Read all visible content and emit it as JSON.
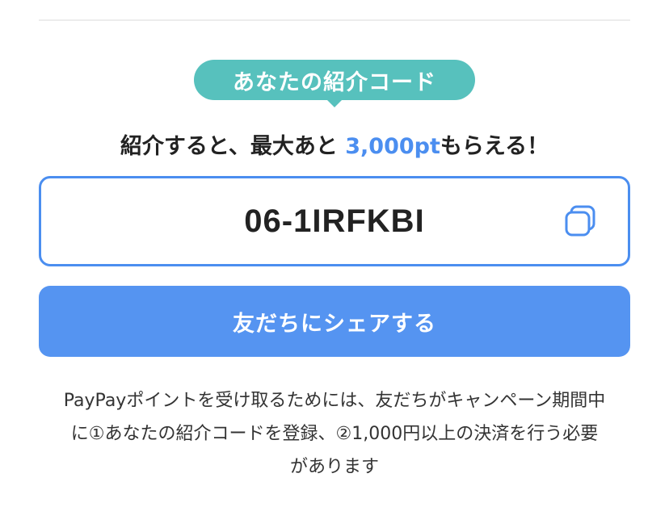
{
  "badge": {
    "label": "あなたの紹介コード"
  },
  "headline": {
    "prefix": "紹介すると、最大あと",
    "amount": "3,000pt",
    "suffix": "もらえる！"
  },
  "referral": {
    "code": "06-1IRFKBI",
    "copy_icon": "copy-icon"
  },
  "share": {
    "label": "友だちにシェアする"
  },
  "notice": {
    "line1": "PayPayポイントを受け取るためには、友だちがキャンペーン期間中",
    "line2": "に①あなたの紹介コードを登録、②1,000円以上の決済を行う必要",
    "line3": "があります"
  },
  "colors": {
    "badge": "#57c1bd",
    "accent": "#4b8ef0",
    "button": "#5594f1"
  }
}
